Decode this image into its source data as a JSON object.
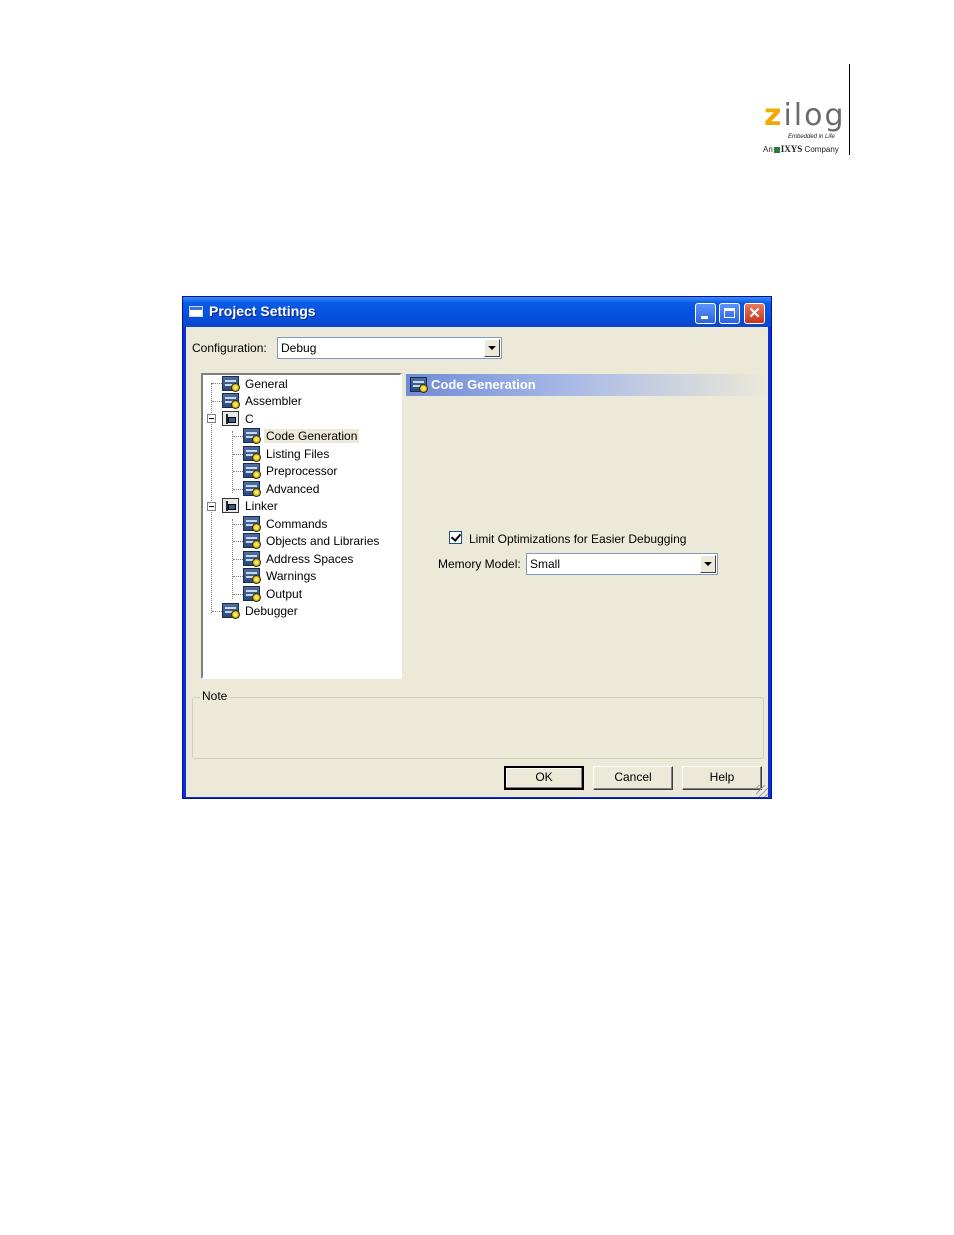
{
  "logo": {
    "wordmark": "zilog",
    "tagline": "Embedded in Life",
    "company_prefix": "An",
    "company_name": "IXYS",
    "company_suffix": "Company",
    "accent_color": "#f2a900"
  },
  "window": {
    "title": "Project Settings",
    "controls": {
      "minimize_icon": "minimize-icon",
      "maximize_icon": "maximize-icon",
      "close_icon": "close-icon",
      "close_glyph": "✕"
    }
  },
  "configuration": {
    "label": "Configuration:",
    "value": "Debug"
  },
  "tree": {
    "items": [
      {
        "label": "General",
        "icon": "settings-page-icon"
      },
      {
        "label": "Assembler",
        "icon": "settings-page-icon"
      },
      {
        "label": "C",
        "icon": "folder-icon",
        "expanded": true
      },
      {
        "label": "Code Generation",
        "icon": "settings-page-icon",
        "selected": true
      },
      {
        "label": "Listing Files",
        "icon": "settings-page-icon"
      },
      {
        "label": "Preprocessor",
        "icon": "settings-page-icon"
      },
      {
        "label": "Advanced",
        "icon": "settings-page-icon"
      },
      {
        "label": "Linker",
        "icon": "folder-icon",
        "expanded": true
      },
      {
        "label": "Commands",
        "icon": "settings-page-icon"
      },
      {
        "label": "Objects and Libraries",
        "icon": "settings-page-icon"
      },
      {
        "label": "Address Spaces",
        "icon": "settings-page-icon"
      },
      {
        "label": "Warnings",
        "icon": "settings-page-icon"
      },
      {
        "label": "Output",
        "icon": "settings-page-icon"
      },
      {
        "label": "Debugger",
        "icon": "settings-page-icon"
      }
    ]
  },
  "panel": {
    "title": "Code Generation",
    "limit_optimizations": {
      "label": "Limit Optimizations for Easier Debugging",
      "checked": true
    },
    "memory_model": {
      "label": "Memory Model:",
      "value": "Small"
    }
  },
  "note": {
    "label": "Note"
  },
  "buttons": {
    "ok": "OK",
    "cancel": "Cancel",
    "help": "Help"
  }
}
